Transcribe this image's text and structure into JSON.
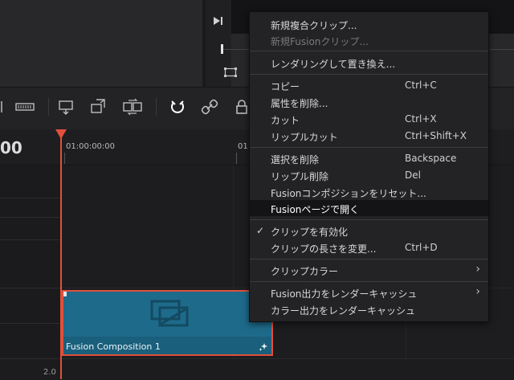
{
  "timeline": {
    "timecode": "00",
    "ruler_labels": [
      "01:00:00:00",
      "01"
    ],
    "zoom_label": "2.0"
  },
  "clip": {
    "name": "Fusion Composition 1"
  },
  "context_menu": {
    "items": [
      {
        "label": "新規複合クリップ...",
        "shortcut": "",
        "disabled": false
      },
      {
        "label": "新規Fusionクリップ...",
        "shortcut": "",
        "disabled": true
      },
      {
        "label": "レンダリングして置き換え...",
        "shortcut": "",
        "disabled": false
      },
      {
        "label": "コピー",
        "shortcut": "Ctrl+C",
        "disabled": false
      },
      {
        "label": "属性を削除...",
        "shortcut": "",
        "disabled": false
      },
      {
        "label": "カット",
        "shortcut": "Ctrl+X",
        "disabled": false
      },
      {
        "label": "リップルカット",
        "shortcut": "Ctrl+Shift+X",
        "disabled": false
      },
      {
        "label": "選択を削除",
        "shortcut": "Backspace",
        "disabled": false
      },
      {
        "label": "リップル削除",
        "shortcut": "Del",
        "disabled": false
      },
      {
        "label": "Fusionコンポジションをリセット...",
        "shortcut": "",
        "disabled": false
      },
      {
        "label": "Fusionページで開く",
        "shortcut": "",
        "disabled": false,
        "highlighted": true
      },
      {
        "label": "クリップを有効化",
        "shortcut": "",
        "disabled": false,
        "checked": true
      },
      {
        "label": "クリップの長さを変更...",
        "shortcut": "Ctrl+D",
        "disabled": false
      },
      {
        "label": "クリップカラー",
        "shortcut": "",
        "disabled": false,
        "submenu": true
      },
      {
        "label": "Fusion出力をレンダーキャッシュ",
        "shortcut": "",
        "disabled": false,
        "submenu": true
      },
      {
        "label": "カラー出力をレンダーキャッシュ",
        "shortcut": "",
        "disabled": false
      }
    ]
  },
  "colors": {
    "accent_playhead": "#e0503c",
    "clip_fill": "#1e6a8a",
    "menu_bg": "#232326",
    "menu_highlight": "#141416"
  }
}
